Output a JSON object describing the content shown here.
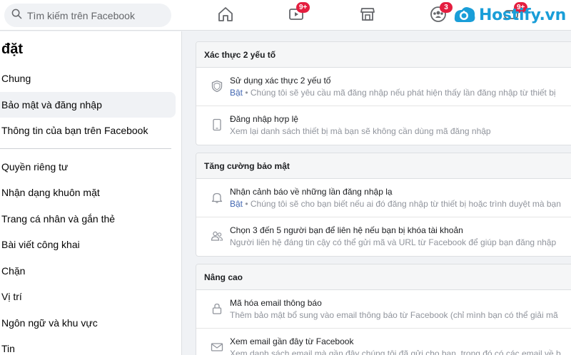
{
  "search": {
    "placeholder": "Tìm kiếm trên Facebook"
  },
  "topnav": {
    "watch_badge": "9+",
    "groups_badge": "3",
    "gaming_badge": "9+"
  },
  "watermark": {
    "text": "Hostify.vn"
  },
  "sidebar": {
    "title": "đặt",
    "items": [
      {
        "label": "Chung"
      },
      {
        "label": "Bảo mật và đăng nhập"
      },
      {
        "label": "Thông tin của bạn trên Facebook"
      },
      {
        "label": "Quyền riêng tư"
      },
      {
        "label": "Nhận dạng khuôn mặt"
      },
      {
        "label": "Trang cá nhân và gắn thẻ"
      },
      {
        "label": "Bài viết công khai"
      },
      {
        "label": "Chặn"
      },
      {
        "label": "Vị trí"
      },
      {
        "label": "Ngôn ngữ và khu vực"
      },
      {
        "label": "Tin"
      }
    ]
  },
  "sections": [
    {
      "header": "Xác thực 2 yếu tố",
      "rows": [
        {
          "icon": "shield-icon",
          "title": "Sử dụng xác thực 2 yếu tố",
          "status": "Bật",
          "desc": " • Chúng tôi sẽ yêu cầu mã đăng nhập nếu phát hiện thấy lần đăng nhập từ thiết bị"
        },
        {
          "icon": "phone-icon",
          "title": "Đăng nhập hợp lệ",
          "desc": "Xem lại danh sách thiết bị mà bạn sẽ không cần dùng mã đăng nhập"
        }
      ]
    },
    {
      "header": "Tăng cường bảo mật",
      "rows": [
        {
          "icon": "bell-icon",
          "title": "Nhận cảnh báo về những lần đăng nhập lạ",
          "status": "Bật",
          "desc": " • Chúng tôi sẽ cho bạn biết nếu ai đó đăng nhập từ thiết bị hoặc trình duyệt mà bạn"
        },
        {
          "icon": "people-icon",
          "title": "Chọn 3 đến 5 người bạn để liên hệ nếu bạn bị khóa tài khoản",
          "desc": "Người liên hệ đáng tin cậy có thể gửi mã và URL từ Facebook để giúp bạn đăng nhập"
        }
      ]
    },
    {
      "header": "Nâng cao",
      "rows": [
        {
          "icon": "lock-icon",
          "title": "Mã hóa email thông báo",
          "desc": "Thêm bảo mật bổ sung vào email thông báo từ Facebook (chỉ mình bạn có thể giải mã"
        },
        {
          "icon": "envelope-icon",
          "title": "Xem email gần đây từ Facebook",
          "desc": "Xem danh sách email mà gần đây chúng tôi đã gửi cho bạn, trong đó có các email về b"
        }
      ]
    }
  ]
}
